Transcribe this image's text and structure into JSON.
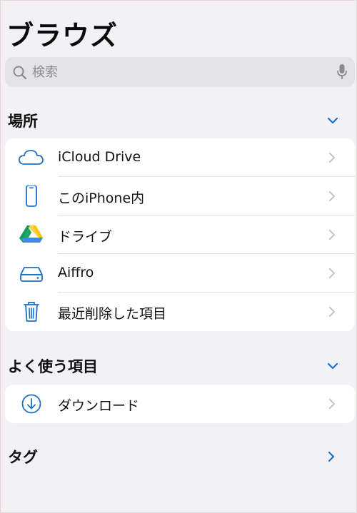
{
  "header": {
    "title": "ブラウズ"
  },
  "search": {
    "placeholder": "検索",
    "value": ""
  },
  "sections": {
    "locations": {
      "title": "場所",
      "items": [
        {
          "label": "iCloud Drive",
          "icon": "cloud-icon"
        },
        {
          "label": "このiPhone内",
          "icon": "iphone-icon"
        },
        {
          "label": "ドライブ",
          "icon": "google-drive-icon"
        },
        {
          "label": "Aiffro",
          "icon": "external-drive-icon"
        },
        {
          "label": "最近削除した項目",
          "icon": "trash-icon"
        }
      ]
    },
    "favorites": {
      "title": "よく使う項目",
      "items": [
        {
          "label": "ダウンロード",
          "icon": "download-icon"
        }
      ]
    },
    "tags": {
      "title": "タグ"
    }
  },
  "colors": {
    "accent": "#1e6fc7",
    "background": "#f2f2f6",
    "card": "#ffffff",
    "chevron_gray": "#c4c4c8"
  }
}
